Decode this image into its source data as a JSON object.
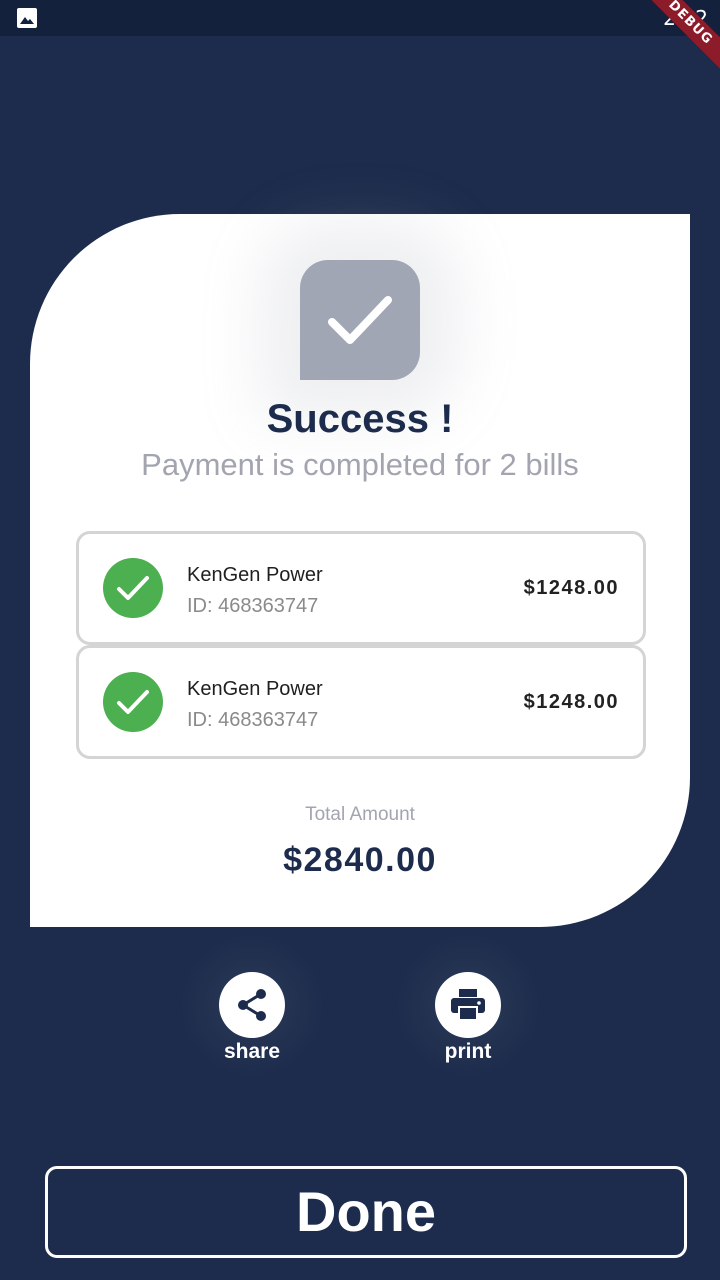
{
  "status_bar": {
    "time": "2:52",
    "debug_label": "DEBUG",
    "image_icon": "image-icon"
  },
  "receipt": {
    "status_icon": "check-icon",
    "title": "Success !",
    "subtitle": "Payment is completed for 2 bills",
    "bills": [
      {
        "name": "KenGen Power",
        "id": "ID: 468363747",
        "amount": "$1248.00",
        "icon": "check-circle-icon"
      },
      {
        "name": "KenGen Power",
        "id": "ID: 468363747",
        "amount": "$1248.00",
        "icon": "check-circle-icon"
      }
    ],
    "total_label": "Total Amount",
    "total_value": "$2840.00"
  },
  "actions": {
    "share": {
      "label": "share",
      "icon": "share-icon"
    },
    "print": {
      "label": "print",
      "icon": "print-icon"
    }
  },
  "done_label": "Done",
  "colors": {
    "background": "#1d2c4c",
    "status_bar": "#13213d",
    "card": "#ffffff",
    "success_green": "#4caf50",
    "check_tile": "#a1a6b4",
    "title_navy": "#1d2c4c",
    "muted_text": "#a2a5b0"
  }
}
